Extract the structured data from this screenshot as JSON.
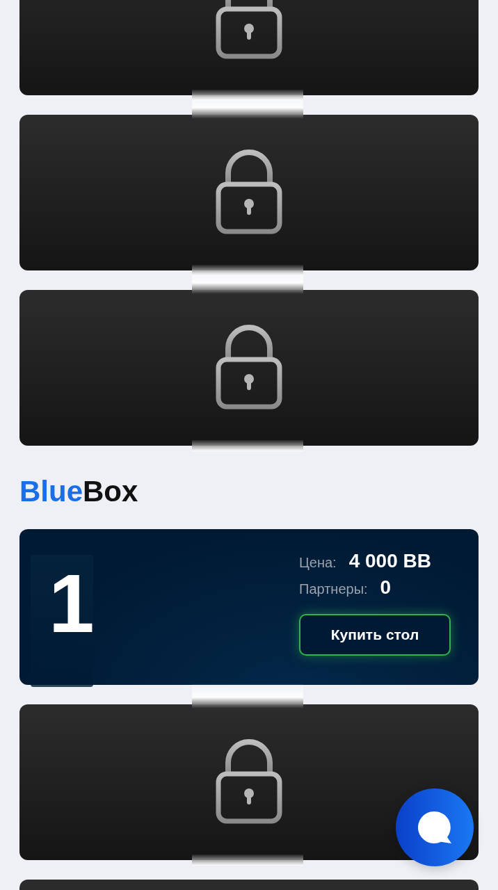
{
  "cards_top": [
    {
      "kind": "locked"
    },
    {
      "kind": "locked"
    },
    {
      "kind": "locked"
    }
  ],
  "section": {
    "title_accent": "Blue",
    "title_rest": "Box",
    "cards": [
      {
        "kind": "table",
        "number": "1",
        "price_label": "Цена:",
        "price": "4 000 BB",
        "partners_label": "Партнеры:",
        "partners": "0",
        "button": "Купить стол"
      },
      {
        "kind": "locked"
      },
      {
        "kind": "cut"
      }
    ]
  },
  "chat_button": {
    "kind": "chat"
  }
}
